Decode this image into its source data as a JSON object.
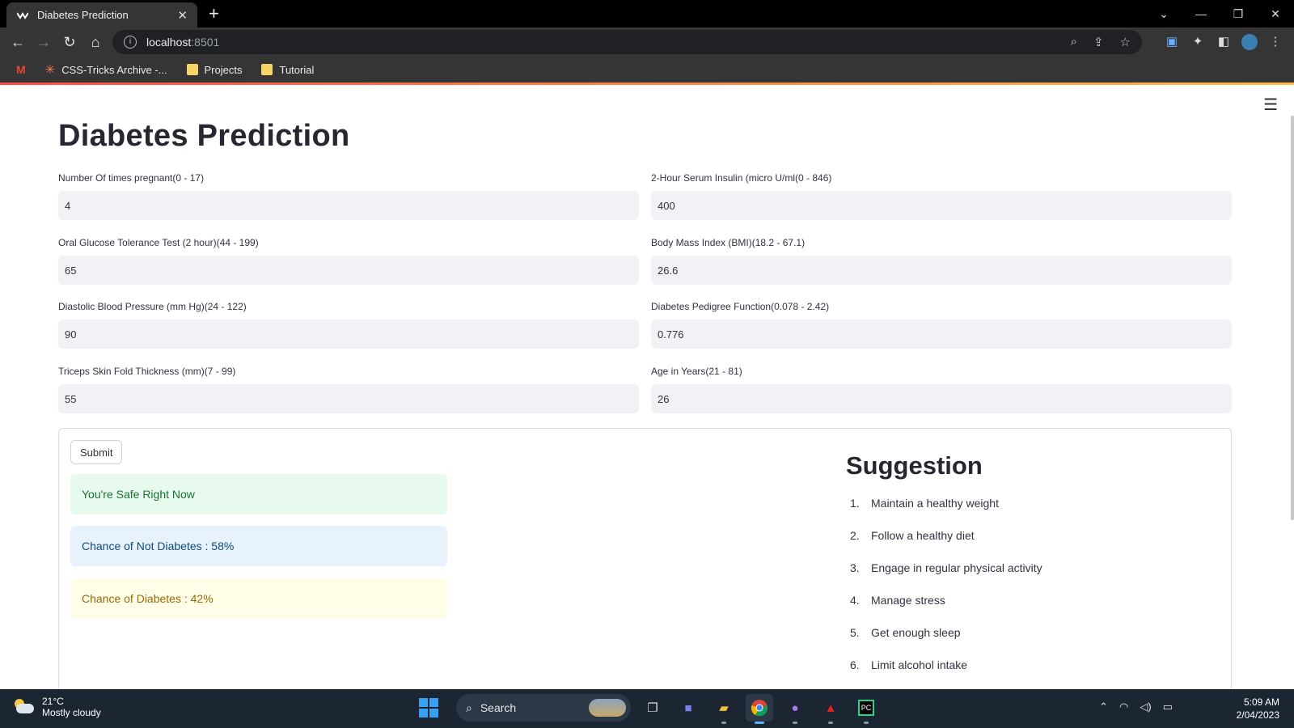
{
  "browser": {
    "tab_title": "Diabetes Prediction",
    "tab_close": "✕",
    "new_tab": "+",
    "url_host": "localhost",
    "url_port": ":8501",
    "bookmarks": [
      {
        "label": "CSS-Tricks Archive -..."
      },
      {
        "label": "Projects"
      },
      {
        "label": "Tutorial"
      }
    ]
  },
  "page": {
    "title": "Diabetes Prediction",
    "fields": [
      {
        "label": "Number Of times pregnant(0 - 17)",
        "value": "4"
      },
      {
        "label": "2-Hour Serum Insulin (micro U/ml(0 - 846)",
        "value": "400"
      },
      {
        "label": "Oral Glucose Tolerance Test (2 hour)(44 - 199)",
        "value": "65"
      },
      {
        "label": "Body Mass Index (BMI)(18.2 - 67.1)",
        "value": "26.6"
      },
      {
        "label": "Diastolic Blood Pressure (mm Hg)(24 - 122)",
        "value": "90"
      },
      {
        "label": "Diabetes Pedigree Function(0.078 - 2.42)",
        "value": "0.776"
      },
      {
        "label": "Triceps Skin Fold Thickness (mm)(7 - 99)",
        "value": "55"
      },
      {
        "label": "Age in Years(21 - 81)",
        "value": "26"
      }
    ],
    "submit_label": "Submit",
    "alerts": {
      "success": "You're Safe Right Now",
      "info": "Chance of Not Diabetes : 58%",
      "warning": "Chance of Diabetes : 42%"
    },
    "suggestion": {
      "title": "Suggestion",
      "items": [
        {
          "n": "1.",
          "text": "Maintain a healthy weight"
        },
        {
          "n": "2.",
          "text": "Follow a healthy diet"
        },
        {
          "n": "3.",
          "text": "Engage in regular physical activity"
        },
        {
          "n": "4.",
          "text": "Manage stress"
        },
        {
          "n": "5.",
          "text": "Get enough sleep"
        },
        {
          "n": "6.",
          "text": "Limit alcohol intake"
        }
      ]
    }
  },
  "taskbar": {
    "temp": "21°C",
    "weather": "Mostly cloudy",
    "search": "Search",
    "time": "5:09 AM",
    "date": "2/04/2023"
  },
  "colors": {
    "success_bg": "#e8f9ee",
    "info_bg": "#e8f2fc",
    "warning_bg": "#fffce7",
    "accent_gradient_start": "#ff4b4b",
    "accent_gradient_end": "#ffbd45"
  }
}
